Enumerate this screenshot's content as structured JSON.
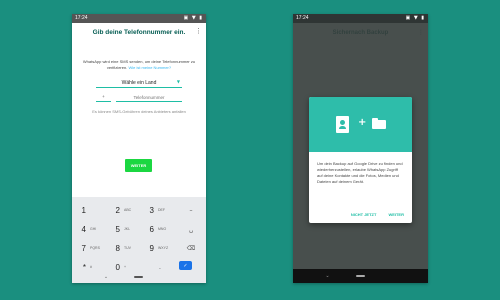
{
  "left_screen": {
    "status_time": "17:24",
    "status_icons": "▣ ▼ ▮",
    "title": "Gib deine Telefonnummer ein.",
    "menu_icon": "⋮",
    "description": "WhatsApp wird eine SMS senden, um deine Telefonnummer zu verifizieren.",
    "description_link": "Wie ist meine Nummer?",
    "country_select": "Wähle ein Land",
    "country_caret": "▼",
    "country_code": "+",
    "phone_placeholder": "Telefonnummer",
    "carrier_note": "Es können SMS-Gebühren deines Anbieters anfallen",
    "next_button": "WEITER",
    "keypad": [
      {
        "digit": "1",
        "letters": ""
      },
      {
        "digit": "2",
        "letters": "ABC"
      },
      {
        "digit": "3",
        "letters": "DEF"
      },
      {
        "action": "–"
      },
      {
        "digit": "4",
        "letters": "GHI"
      },
      {
        "digit": "5",
        "letters": "JKL"
      },
      {
        "digit": "6",
        "letters": "MNO"
      },
      {
        "action": "␣"
      },
      {
        "digit": "7",
        "letters": "PQRS"
      },
      {
        "digit": "8",
        "letters": "TUV"
      },
      {
        "digit": "9",
        "letters": "WXYZ"
      },
      {
        "action": "⌫"
      },
      {
        "digit": "*",
        "letters": "#"
      },
      {
        "digit": "0",
        "letters": "+"
      },
      {
        "action": "."
      },
      {
        "action": "✓"
      }
    ],
    "nav_back": "⌄"
  },
  "right_screen": {
    "status_time": "17:24",
    "status_icons": "▣ ▼ ▮",
    "background_title": "Sichernach Backup",
    "background_icon": "⋮",
    "dialog_text": "Um dein Backup auf Google Drive zu finden und wiederherzustellen, erlaube WhatsApp Zugriff auf deine Kontakte und die Fotos, Medien und Dateien auf deinem Gerät.",
    "not_now_button": "NICHT JETZT",
    "continue_button": "WEITER",
    "nav_back": "⌄"
  },
  "colors": {
    "background": "#1a8f7f",
    "accent": "#1ebea5",
    "title": "#075e54",
    "button_green": "#1bd741",
    "dialog_banner": "#2ebdaa"
  }
}
